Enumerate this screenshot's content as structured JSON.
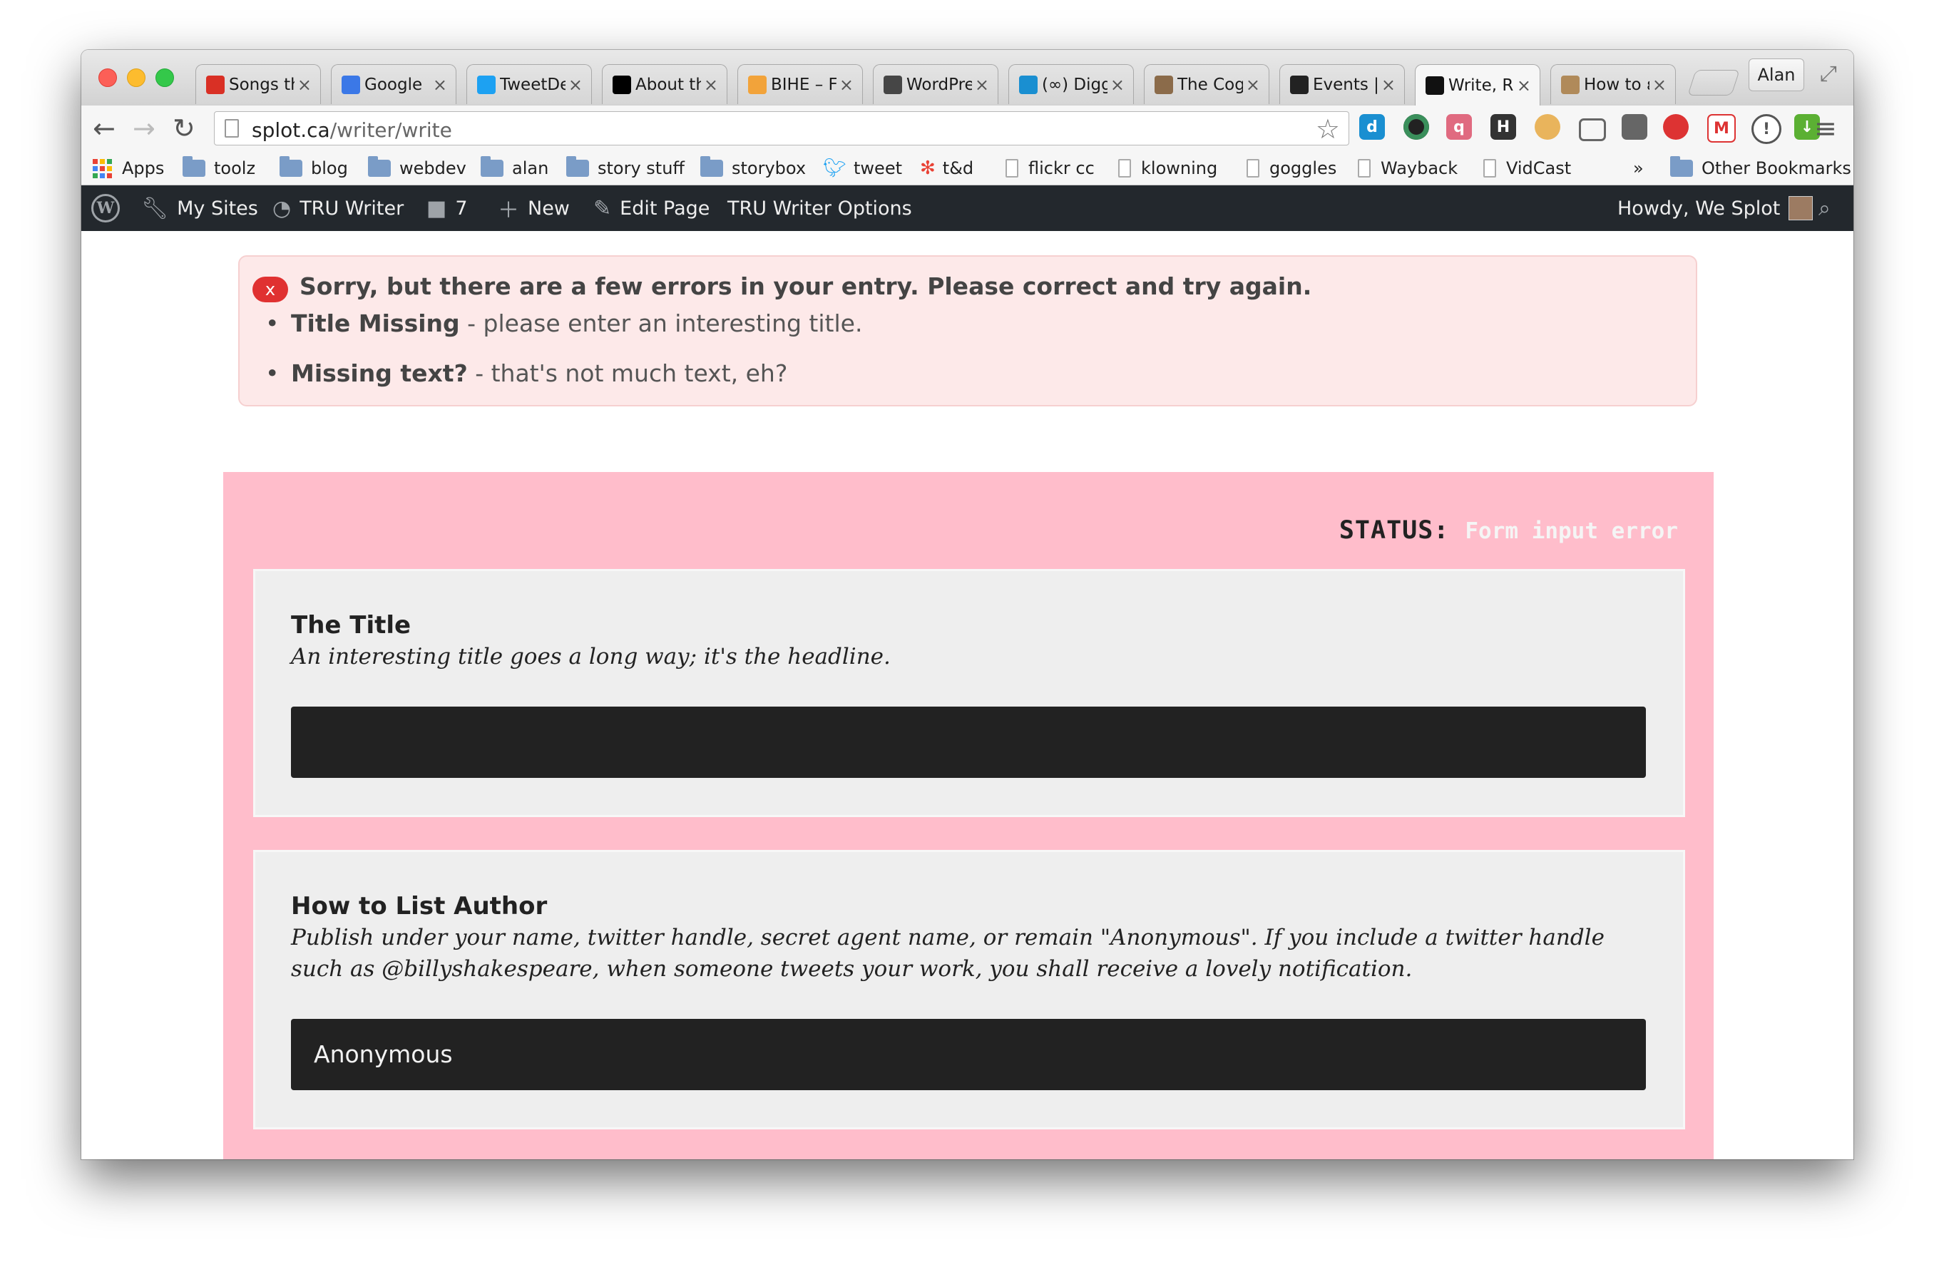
{
  "browser": {
    "tabs": [
      {
        "title": "Songs th",
        "icon": "gmail-icon",
        "color": "#d93025"
      },
      {
        "title": "Google",
        "icon": "google-sites-icon",
        "color": "#3b78e7"
      },
      {
        "title": "TweetDe",
        "icon": "twitter-bird-icon",
        "color": "#1da1f2"
      },
      {
        "title": "About th",
        "icon": "edu-icon",
        "color": "#000000"
      },
      {
        "title": "BIHE – F",
        "icon": "bihe-icon",
        "color": "#f2a33a"
      },
      {
        "title": "WordPre",
        "icon": "wordpress-icon",
        "color": "#464646"
      },
      {
        "title": "(∞) Digg",
        "icon": "digg-icon",
        "color": "#1a8fd1"
      },
      {
        "title": "The Cog",
        "icon": "cog-avatar-icon",
        "color": "#8b6b4a"
      },
      {
        "title": "Events |",
        "icon": "camera-icon",
        "color": "#222222"
      },
      {
        "title": "Write, R",
        "icon": "splot-icon",
        "color": "#111111",
        "active": true
      },
      {
        "title": "How to ε",
        "icon": "howto-icon",
        "color": "#b08a5a"
      }
    ],
    "profile_name": "Alan",
    "url_host": "splot.ca",
    "url_path": "/writer/write",
    "bookmarks": [
      {
        "label": "Apps",
        "type": "apps"
      },
      {
        "label": "toolz",
        "type": "folder"
      },
      {
        "label": "blog",
        "type": "folder"
      },
      {
        "label": "webdev",
        "type": "folder"
      },
      {
        "label": "alan",
        "type": "folder"
      },
      {
        "label": "story stuff",
        "type": "folder"
      },
      {
        "label": "storybox",
        "type": "folder"
      },
      {
        "label": "tweet",
        "type": "twitter"
      },
      {
        "label": "t&d",
        "type": "td"
      },
      {
        "label": "flickr cc",
        "type": "page"
      },
      {
        "label": "klowning",
        "type": "page"
      },
      {
        "label": "goggles",
        "type": "page"
      },
      {
        "label": "Wayback",
        "type": "page"
      },
      {
        "label": "VidCast",
        "type": "page"
      }
    ],
    "bookmarks_overflow": "»",
    "other_bookmarks": "Other Bookmarks"
  },
  "admin_bar": {
    "my_sites": "My Sites",
    "site_name": "TRU Writer",
    "comments_count": "7",
    "new": "New",
    "edit_page": "Edit Page",
    "writer_options": "TRU Writer Options",
    "howdy": "Howdy, We Splot"
  },
  "errors": {
    "badge": "x",
    "heading": "Sorry, but there are a few errors in your entry. Please correct and try again.",
    "items": [
      {
        "strong": "Title Missing",
        "text": " - please enter an interesting title."
      },
      {
        "strong": "Missing text?",
        "text": " - that's not much text, eh?"
      }
    ]
  },
  "form": {
    "status_label": "STATUS:",
    "status_value": "Form input error",
    "title_field": {
      "label": "The Title",
      "help": "An interesting title goes a long way; it's the headline.",
      "value": ""
    },
    "author_field": {
      "label": "How to List Author",
      "help": "Publish under your name, twitter handle, secret agent name, or remain \"Anonymous\". If you include a twitter handle such as @billyshakespeare, when someone tweets your work, you shall receive a lovely notification.",
      "value": "Anonymous"
    }
  },
  "colors": {
    "form_background": "#ffbdcb",
    "error_background": "#fde9e9",
    "error_badge": "#e03131",
    "input_background": "#222222",
    "admin_bar": "#23282d"
  }
}
